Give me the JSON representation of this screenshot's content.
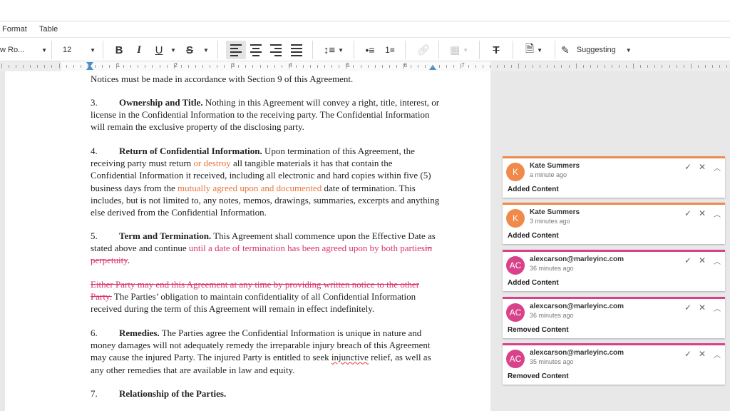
{
  "menu": {
    "format": "Format",
    "table": "Table"
  },
  "toolbar": {
    "font_name": "w Ro...",
    "font_size": "12",
    "bold": "B",
    "italic": "I",
    "underline": "U",
    "strikethrough": "S",
    "suggesting_label": "Suggesting"
  },
  "ruler": {
    "numbers": [
      "1",
      "2",
      "3",
      "4",
      "5",
      "6",
      "7"
    ]
  },
  "document": {
    "notices": "Notices must be made in accordance with Section 9 of this Agreement.",
    "s3": {
      "num": "3.",
      "title": "Ownership and Title.",
      "text": " Nothing in this Agreement will convey a right, title, interest, or license in the Confidential Information to the receiving party.  The Confidential Information will remain the exclusive property of the disclosing party."
    },
    "s4": {
      "num": "4.",
      "title": "Return of Confidential Information.",
      "t1": " Upon termination of this Agreement, the receiving party must return ",
      "ins1": "or destroy",
      "t2": " all tangible materials it has that contain the Confidential Information it received, including all electronic and hard copies within five (5) business days from the ",
      "ins2": "mutually agreed upon and documented",
      "t3": " date of termination.  This includes, but is not limited to, any notes, memos, drawings, summaries, excerpts and anything else derived from the Confidential Information."
    },
    "s5": {
      "num": "5.",
      "title": "Term and Termination.",
      "t1": " This Agreement shall commence upon the Effective Date as stated above and continue ",
      "ins": "until a date of termination has been agreed upon by both parties",
      "del": "in perpetuity",
      "t2": "."
    },
    "p_either": {
      "del": "Either Party may end this Agreement at any time by providing written notice to the other Party.",
      "text": "  The Parties’ obligation to maintain confidentiality of all Confidential Information received during the term of this Agreement will remain in effect indefinitely."
    },
    "s6": {
      "num": "6.",
      "title": "Remedies.",
      "t1": " The Parties agree the Confidential Information is unique in nature and money damages will not adequately remedy the irreparable injury breach of this Agreement may cause the injured Party.  The injured Party is entitled to seek ",
      "spell": "injunctive",
      "t2": " relief, as well as any other remedies that are available in law and equity."
    },
    "s7": {
      "num": "7.",
      "title": "Relationship of the Parties."
    }
  },
  "suggestions": [
    {
      "initials": "K",
      "name": "Kate Summers",
      "time": "a minute ago",
      "kind": "Added Content",
      "color": "#f08a4b"
    },
    {
      "initials": "K",
      "name": "Kate Summers",
      "time": "3 minutes ago",
      "kind": "Added Content",
      "color": "#f08a4b"
    },
    {
      "initials": "AC",
      "name": "alexcarson@marleyinc.com",
      "time": "36 minutes ago",
      "kind": "Added Content",
      "color": "#d9428a"
    },
    {
      "initials": "AC",
      "name": "alexcarson@marleyinc.com",
      "time": "36 minutes ago",
      "kind": "Removed Content",
      "color": "#d9428a"
    },
    {
      "initials": "AC",
      "name": "alexcarson@marleyinc.com",
      "time": "35 minutes ago",
      "kind": "Removed Content",
      "color": "#d9428a"
    }
  ],
  "colors": {
    "insert_orange": "#e8743b",
    "insert_pink": "#d6336c",
    "accent_blue": "#4a90c8"
  }
}
